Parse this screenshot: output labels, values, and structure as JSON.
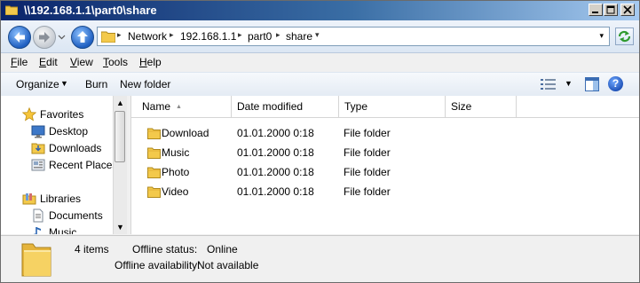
{
  "window": {
    "title": "\\\\192.168.1.1\\part0\\share"
  },
  "address_bar": {
    "crumbs": [
      "Network",
      "192.168.1.1",
      "part0",
      "share"
    ]
  },
  "menu": {
    "items": [
      {
        "label_u": "F",
        "label_rest": "ile"
      },
      {
        "label_u": "E",
        "label_rest": "dit"
      },
      {
        "label_u": "V",
        "label_rest": "iew"
      },
      {
        "label_u": "T",
        "label_rest": "ools"
      },
      {
        "label_u": "H",
        "label_rest": "elp"
      }
    ]
  },
  "toolbar": {
    "organize": "Organize",
    "burn": "Burn",
    "new_folder": "New folder",
    "help_glyph": "?"
  },
  "nav_pane": {
    "favorites_header": "Favorites",
    "favorites": [
      "Desktop",
      "Downloads",
      "Recent Places"
    ],
    "libraries_header": "Libraries",
    "libraries": [
      "Documents",
      "Music"
    ]
  },
  "columns": {
    "name": "Name",
    "date": "Date modified",
    "type": "Type",
    "size": "Size"
  },
  "files": [
    {
      "name": "Download",
      "date": "01.01.2000 0:18",
      "type": "File folder",
      "size": ""
    },
    {
      "name": "Music",
      "date": "01.01.2000 0:18",
      "type": "File folder",
      "size": ""
    },
    {
      "name": "Photo",
      "date": "01.01.2000 0:18",
      "type": "File folder",
      "size": ""
    },
    {
      "name": "Video",
      "date": "01.01.2000 0:18",
      "type": "File folder",
      "size": ""
    }
  ],
  "details": {
    "item_count": "4 items",
    "offline_status_label": "Offline status:",
    "offline_status_value": "Online",
    "offline_availability_label": "Offline availability:",
    "offline_availability_value": "Not available"
  },
  "icons": {
    "folder": "folder-icon",
    "back": "back-arrow-icon",
    "forward": "forward-arrow-icon",
    "up": "up-arrow-icon",
    "refresh": "refresh-icon",
    "favorites": "star-icon",
    "libraries": "libraries-icon",
    "help": "help-icon"
  },
  "colors": {
    "title_gradient_start": "#0a246a",
    "folder_yellow": "#f3c94b",
    "accent_blue": "#1f5fc1"
  }
}
